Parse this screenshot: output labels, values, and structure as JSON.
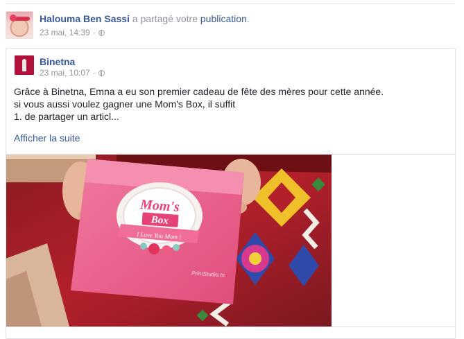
{
  "share": {
    "sharer_name": "Halouma Ben Sassi",
    "action_text": "a partagé votre",
    "object_link": "publication",
    "period": ".",
    "timestamp": "23 mai, 14:39",
    "separator": "·",
    "privacy_icon": "globe-icon"
  },
  "post": {
    "page_name": "Binetna",
    "timestamp": "23 mai, 10:07",
    "separator": "·",
    "privacy_icon": "globe-icon",
    "lines": [
      "Grâce à Binetna, Emna a eu son premier cadeau de fête des mères pour cette année.",
      "si vous aussi voulez gagner une Mom's Box, il suffit",
      "1. de partager un articl..."
    ],
    "see_more": "Afficher la suite"
  },
  "photo": {
    "box_title_line1": "Mom's",
    "box_title_line2": "Box",
    "ribbon_text": "I Love You Mom !",
    "printer_mark": "PrintStudio.tn"
  },
  "colors": {
    "link": "#365899",
    "muted": "#90949c",
    "text": "#1d2129",
    "box_pink": "#e85a86"
  }
}
